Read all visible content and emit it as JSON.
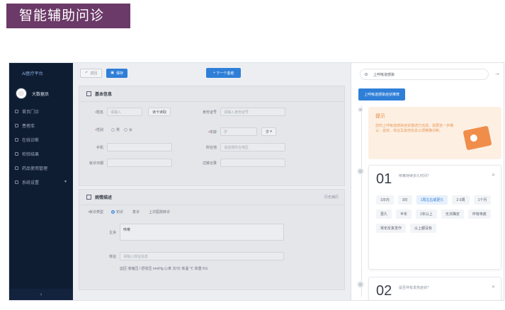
{
  "banner": {
    "title": "智能辅助问诊"
  },
  "sidebar": {
    "brand": "AI医疗平台",
    "user": "大数据员",
    "items": [
      {
        "label": "首页门诊",
        "icon": "home-icon"
      },
      {
        "label": "患者库",
        "icon": "users-icon"
      },
      {
        "label": "在线诊断",
        "icon": "doc-icon"
      },
      {
        "label": "检验结果",
        "icon": "report-icon"
      },
      {
        "label": "药品使用管理",
        "icon": "pill-icon"
      },
      {
        "label": "系统设置",
        "icon": "gear-icon",
        "expandable": true
      }
    ],
    "collapse": "‹"
  },
  "toolbar": {
    "back": "返回",
    "save": "保存",
    "next": "下一个患者"
  },
  "basic": {
    "title": "基本信息",
    "name_label": "姓名",
    "name_placeholder": "请输入",
    "read_card": "读卡读取",
    "id_label": "身份证号",
    "id_placeholder": "请输入身份证号",
    "sex_label": "性别",
    "sex_opt1": "男",
    "sex_opt2": "女",
    "age_label": "年龄",
    "age_value": "岁",
    "age_unit": "岁",
    "phone_label": "手机",
    "region_label": "所在地",
    "region_placeholder": "请选择所在地区",
    "visit_label": "就诊日期",
    "visit_placeholder": "",
    "record_label": "过敏记录",
    "record_placeholder": ""
  },
  "symptom": {
    "title": "病情描述",
    "action": "历史病历",
    "type_label": "就诊类型",
    "type_opt1": "初诊",
    "type_opt2": "复诊",
    "type_opt3": "上次医院转诊",
    "complaint_label": "主诉",
    "complaint_value": "咳嗽",
    "history_label": "体征",
    "history_placeholder": "请输入体征信息",
    "vitals": "血压  收缩压  /  舒张压  mmHg  心率  次/分  体温  ℃  体重  KG"
  },
  "right": {
    "search_value": "上呼吸道感染",
    "button": "上呼吸道感染症状推荐",
    "tip_title": "提示",
    "tip_text": "您的上呼吸道感染症状描述已完成，需要进一步确认：症状、体征及其他信息以便精确诊断。",
    "q1": {
      "num": "01",
      "title": "咳嗽持续多久时间？",
      "chips": [
        "1日内",
        "3日",
        "1周左右或更久",
        "2-3周",
        "1个月",
        "更久",
        "半年",
        "1年以上",
        "无法确定",
        "伴有咳痰",
        "常年反复发作",
        "以上都没有"
      ]
    },
    "q2": {
      "num": "02",
      "title": "是否伴有发热症状？"
    }
  }
}
